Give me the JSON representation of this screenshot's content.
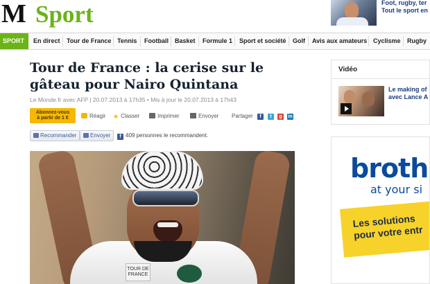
{
  "masthead": {
    "logo_m": "M",
    "logo_sport": "Sport",
    "promo_line1": "Foot, rugby, ter",
    "promo_line2": "Tout le sport en"
  },
  "nav": {
    "items": [
      "SPORT",
      "En direct",
      "Tour de France",
      "Tennis",
      "Football",
      "Basket",
      "Formule 1",
      "Sport et société",
      "Golf",
      "Avis aux amateurs",
      "Cyclisme",
      "Rugby"
    ],
    "active_color": "#6ab417"
  },
  "article": {
    "headline": "Tour de France : la cerise sur le gâteau pour Nairo Quintana",
    "meta": "Le Monde.fr avec AFP | 20.07.2013 à 17h35 • Mis à jour le 20.07.2013 à 17h43",
    "subscribe_line1": "Abonnez-vous",
    "subscribe_line2": "à partir de 1 €",
    "tools": {
      "react": "Réagir",
      "classer": "Classer",
      "print": "Imprimer",
      "send": "Envoyer"
    },
    "share_label": "Partager",
    "share_icons": [
      "facebook-icon",
      "twitter-icon",
      "googleplus-icon",
      "linkedin-icon"
    ],
    "recommend_label": "Recommander",
    "send_label": "Envoyer",
    "fb_count": "409 personnes le recommandent.",
    "photo_badge": "TOUR DE FRANCE"
  },
  "sidebar": {
    "video_title": "Vidéo",
    "video_caption_line1": "Le making of",
    "video_caption_line2": "avec Lance A"
  },
  "ad": {
    "brand": "broth",
    "tagline": "at your si",
    "solutions_line1": "Les solutions",
    "solutions_line2": "pour votre entr"
  },
  "colors": {
    "sport_green": "#6ab417",
    "subscribe_yellow": "#f6b800",
    "brother_blue": "#0b4a9c",
    "ad_yellow": "#f7d22a"
  }
}
